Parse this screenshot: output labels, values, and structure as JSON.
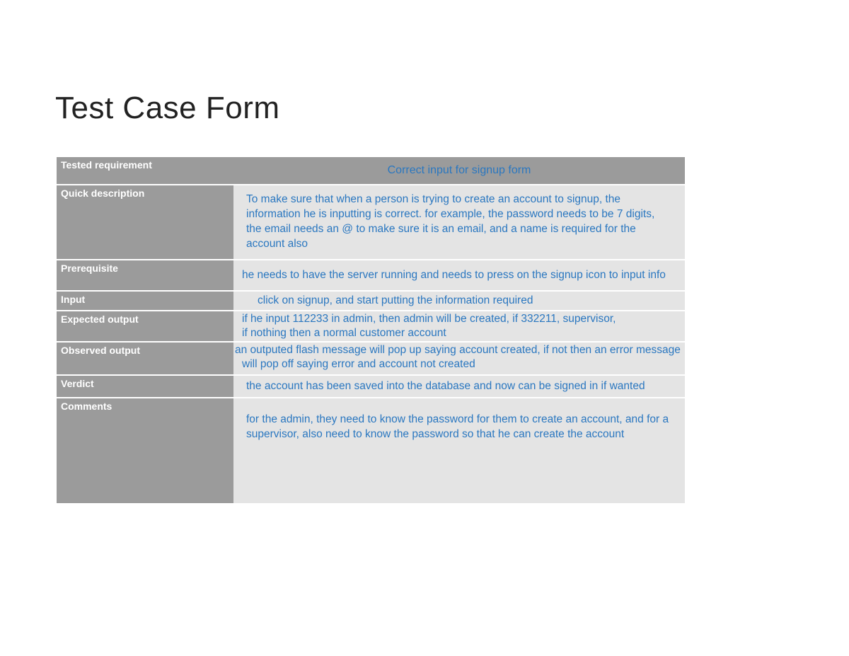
{
  "title": "Test Case Form",
  "rows": {
    "tested_requirement": {
      "label": "Tested requirement",
      "value": "Correct input for signup form"
    },
    "quick_description": {
      "label": "Quick description",
      "value": "To make sure that when a person is trying to create an account to signup, the information he is inputting is correct. for example, the password needs to be 7 digits, the email needs an @ to make sure it is an email, and a name is required for the account also"
    },
    "prerequisite": {
      "label": "Prerequisite",
      "value": "he needs to have the server running and needs to press on the signup icon to input info"
    },
    "input": {
      "label": "Input",
      "value": "click on signup, and start putting the information required"
    },
    "expected_output": {
      "label": "Expected output",
      "line1": "if he input 112233 in admin, then admin will be created, if 332211, supervisor,",
      "line2": " if nothing then a normal customer account"
    },
    "observed_output": {
      "label": "Observed output",
      "line1": "an outputed flash message will pop up saying account created, if not then an error message",
      "line2": "will pop off saying error and account not created"
    },
    "verdict": {
      "label": "Verdict",
      "value": "the account has been saved into the database and now can be signed in if wanted"
    },
    "comments": {
      "label": "Comments",
      "value": "for the admin, they need to know the password for them to create an account, and for a supervisor, also need to know the password so that he can create the account"
    }
  }
}
